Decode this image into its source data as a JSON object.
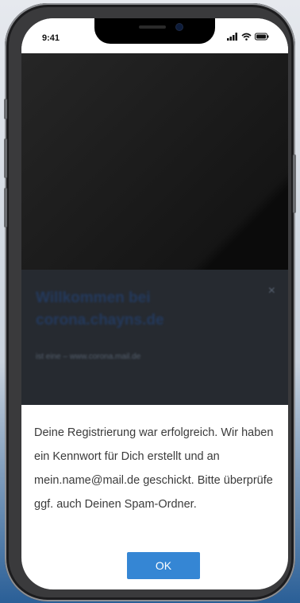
{
  "status_bar": {
    "time": "9:41",
    "icons": [
      "signal-icon",
      "wifi-icon",
      "battery-icon"
    ]
  },
  "background_app": {
    "welcome_title": "Willkommen bei corona.chayns.de",
    "welcome_subline": "ist eine – www.corona.mail.de"
  },
  "dialog": {
    "message": "Deine Registrierung war erfolgreich. Wir haben ein Kennwort für Dich erstellt und an mein.name@mail.de geschickt. Bitte überprüfe ggf. auch Deinen Spam-Ordner.",
    "ok_label": "OK"
  },
  "colors": {
    "accent": "#3586d4",
    "backdrop": "#1b4f86"
  }
}
